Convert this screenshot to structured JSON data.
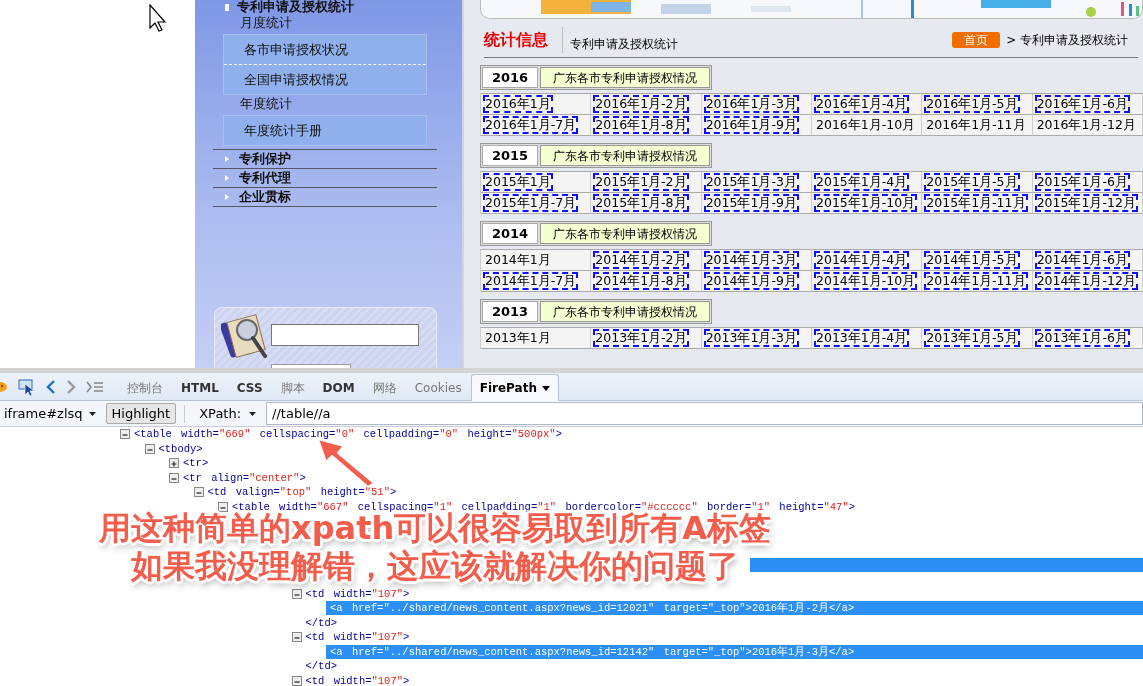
{
  "sidebar": {
    "heading": "专利申请及授权统计",
    "groups": [
      {
        "label": "月度统计",
        "items": [
          {
            "label": "各市申请授权状况"
          },
          {
            "label": "全国申请授权情况"
          }
        ]
      },
      {
        "label": "年度统计",
        "items": [
          {
            "label": "年度统计手册"
          }
        ]
      }
    ],
    "menu": [
      "专利保护",
      "专利代理",
      "企业贯标"
    ]
  },
  "content": {
    "title": "统计信息",
    "subtitle": "专利申请及授权统计",
    "home_button": "首页",
    "breadcrumb": "> 专利申请及授权统计",
    "years": [
      {
        "year": "2016",
        "caption": "广东各市专利申请授权情况",
        "rows": [
          [
            {
              "label": "2016年1月",
              "highlighted": true
            },
            {
              "label": "2016年1月-2月",
              "highlighted": true
            },
            {
              "label": "2016年1月-3月",
              "highlighted": true
            },
            {
              "label": "2016年1月-4月",
              "highlighted": true
            },
            {
              "label": "2016年1月-5月",
              "highlighted": true
            },
            {
              "label": "2016年1月-6月",
              "highlighted": true
            }
          ],
          [
            {
              "label": "2016年1月-7月",
              "highlighted": true
            },
            {
              "label": "2016年1月-8月",
              "highlighted": true
            },
            {
              "label": "2016年1月-9月",
              "highlighted": true
            },
            {
              "label": "2016年1月-10月",
              "highlighted": false
            },
            {
              "label": "2016年1月-11月",
              "highlighted": false
            },
            {
              "label": "2016年1月-12月",
              "highlighted": false
            }
          ]
        ]
      },
      {
        "year": "2015",
        "caption": "广东各市专利申请授权情况",
        "rows": [
          [
            {
              "label": "2015年1月",
              "highlighted": true
            },
            {
              "label": "2015年1月-2月",
              "highlighted": true
            },
            {
              "label": "2015年1月-3月",
              "highlighted": true
            },
            {
              "label": "2015年1月-4月",
              "highlighted": true
            },
            {
              "label": "2015年1月-5月",
              "highlighted": true
            },
            {
              "label": "2015年1月-6月",
              "highlighted": true
            }
          ],
          [
            {
              "label": "2015年1月-7月",
              "highlighted": true
            },
            {
              "label": "2015年1月-8月",
              "highlighted": true
            },
            {
              "label": "2015年1月-9月",
              "highlighted": true
            },
            {
              "label": "2015年1月-10月",
              "highlighted": true
            },
            {
              "label": "2015年1月-11月",
              "highlighted": true
            },
            {
              "label": "2015年1月-12月",
              "highlighted": true
            }
          ]
        ]
      },
      {
        "year": "2014",
        "caption": "广东各市专利申请授权情况",
        "rows": [
          [
            {
              "label": "2014年1月",
              "highlighted": false
            },
            {
              "label": "2014年1月-2月",
              "highlighted": true
            },
            {
              "label": "2014年1月-3月",
              "highlighted": true
            },
            {
              "label": "2014年1月-4月",
              "highlighted": true
            },
            {
              "label": "2014年1月-5月",
              "highlighted": true
            },
            {
              "label": "2014年1月-6月",
              "highlighted": true
            }
          ],
          [
            {
              "label": "2014年1月-7月",
              "highlighted": true
            },
            {
              "label": "2014年1月-8月",
              "highlighted": true
            },
            {
              "label": "2014年1月-9月",
              "highlighted": true
            },
            {
              "label": "2014年1月-10月",
              "highlighted": true
            },
            {
              "label": "2014年1月-11月",
              "highlighted": true
            },
            {
              "label": "2014年1月-12月",
              "highlighted": true
            }
          ]
        ]
      },
      {
        "year": "2013",
        "caption": "广东各市专利申请授权情况",
        "rows": [
          [
            {
              "label": "2013年1月",
              "highlighted": false
            },
            {
              "label": "2013年1月-2月",
              "highlighted": true
            },
            {
              "label": "2013年1月-3月",
              "highlighted": true
            },
            {
              "label": "2013年1月-4月",
              "highlighted": true
            },
            {
              "label": "2013年1月-5月",
              "highlighted": true
            },
            {
              "label": "2013年1月-6月",
              "highlighted": true
            }
          ]
        ]
      }
    ]
  },
  "devtools": {
    "tabs": [
      {
        "label": "控制台",
        "selected": false,
        "disabled": true
      },
      {
        "label": "HTML",
        "selected": false,
        "disabled": false
      },
      {
        "label": "CSS",
        "selected": false,
        "disabled": false
      },
      {
        "label": "脚本",
        "selected": false,
        "disabled": true
      },
      {
        "label": "DOM",
        "selected": false,
        "disabled": false
      },
      {
        "label": "网络",
        "selected": false,
        "disabled": true
      },
      {
        "label": "Cookies",
        "selected": false,
        "disabled": true
      },
      {
        "label": "FirePath",
        "selected": true,
        "disabled": false
      }
    ],
    "frame_select": "iframe#zlsq",
    "highlight_button": "Highlight",
    "xpath_label": "XPath:",
    "xpath_value": "//table//a",
    "tree": [
      {
        "kind": "branch",
        "text": "<table width=\"669\" cellspacing=\"0\" cellpadding=\"0\" height=\"500px\">",
        "expanded": true,
        "selected": false,
        "children": [
          {
            "kind": "branch",
            "text": "<tbody>",
            "expanded": true,
            "selected": false,
            "children": [
              {
                "kind": "branch",
                "text": "<tr>",
                "expanded": false,
                "selected": false
              },
              {
                "kind": "branch",
                "text": "<tr align=\"center\">",
                "expanded": true,
                "selected": false,
                "children": [
                  {
                    "kind": "branch",
                    "text": "<td valign=\"top\" height=\"51\">",
                    "expanded": true,
                    "selected": false,
                    "children": [
                      {
                        "kind": "branch",
                        "text": "<table width=\"667\" cellspacing=\"1\" cellpadding=\"1\" bordercolor=\"#cccccc\" border=\"1\" height=\"47\">",
                        "expanded": true,
                        "selected": false,
                        "children": [
                          {
                            "kind": "covered",
                            "children": [
                              {
                                "kind": "covered",
                                "children": [
                                  {
                                    "kind": "covered",
                                    "children": [
                                      {
                                        "kind": "covered",
                                        "selected": true
                                      }
                                    ]
                                  },
                                  {
                                    "kind": "covered"
                                  },
                                  {
                                    "kind": "branch",
                                    "text": "<td width=\"107\">",
                                    "expanded": true,
                                    "selected": false,
                                    "close": "</td>",
                                    "children": [
                                      {
                                        "kind": "leaf",
                                        "text": "<a href=\"../shared/news_content.aspx?news_id=12021\" target=\"_top\">2016年1月-2月</a>",
                                        "selected": true
                                      }
                                    ]
                                  },
                                  {
                                    "kind": "branch",
                                    "text": "<td width=\"107\">",
                                    "expanded": true,
                                    "selected": false,
                                    "close": "</td>",
                                    "children": [
                                      {
                                        "kind": "leaf",
                                        "text": "<a href=\"../shared/news_content.aspx?news_id=12142\" target=\"_top\">2016年1月-3月</a>",
                                        "selected": true
                                      }
                                    ]
                                  },
                                  {
                                    "kind": "branch",
                                    "text": "<td width=\"107\">",
                                    "expanded": true,
                                    "selected": false
                                  }
                                ]
                              }
                            ]
                          }
                        ]
                      }
                    ]
                  }
                ]
              }
            ]
          }
        ]
      }
    ]
  },
  "annotation": {
    "lines": [
      "用这种简单的xpath可以很容易取到所有A标签",
      "如果我没理解错，这应该就解决你的问题了"
    ]
  }
}
